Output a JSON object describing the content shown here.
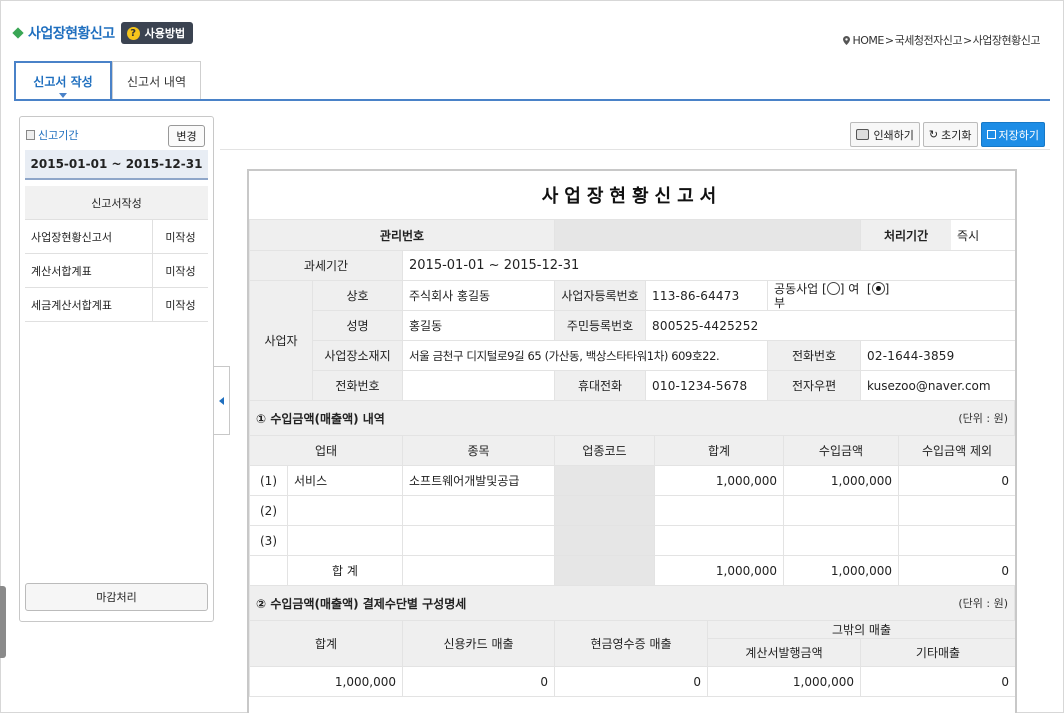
{
  "header": {
    "title": "사업장현황신고",
    "help_label": "사용방법",
    "breadcrumb": [
      "HOME",
      "국세청전자신고",
      "사업장현황신고"
    ],
    "bc_sep": ">"
  },
  "tabs": [
    {
      "label": "신고서 작성",
      "active": true
    },
    {
      "label": "신고서 내역",
      "active": false
    }
  ],
  "left_panel": {
    "period_label": "신고기간",
    "change_label": "변경",
    "period_value": "2015-01-01 ~ 2015-12-31",
    "list_header": "신고서작성",
    "items": [
      {
        "name": "사업장현황신고서",
        "status": "미작성"
      },
      {
        "name": "계산서합계표",
        "status": "미작성"
      },
      {
        "name": "세금계산서합계표",
        "status": "미작성"
      }
    ],
    "close_label": "마감처리"
  },
  "toolbar": {
    "print_label": "인쇄하기",
    "reset_label": "초기화",
    "save_label": "저장하기"
  },
  "form": {
    "title": "사업장현황신고서",
    "mgmt_no_label": "관리번호",
    "mgmt_no_value": "",
    "proc_period_label": "처리기간",
    "proc_period_value": "즉시",
    "tax_period_label": "과세기간",
    "tax_period_value": "2015-01-01 ~ 2015-12-31",
    "business_label": "사업자",
    "company_label": "상호",
    "company_value": "주식회사 홍길동",
    "bizno_label": "사업자등록번호",
    "bizno_value": "113-86-64473",
    "joint_label_1": "공동사업 [",
    "joint_label_2": "] 여",
    "joint_label_3": "[",
    "joint_label_4": "]",
    "joint_label_5": "부",
    "name_label": "성명",
    "name_value": "홍길동",
    "rrn_label": "주민등록번호",
    "rrn_value": "800525-4425252",
    "addr_label": "사업장소재지",
    "addr_value": "서울 금천구 디지털로9길 65 (가산동, 백상스타타워1차) 609호22.",
    "phone_label": "전화번호",
    "phone_value": "02-1644-3859",
    "phone2_label": "전화번호",
    "phone2_value": "",
    "mobile_label": "휴대전화",
    "mobile_value": "010-1234-5678",
    "email_label": "전자우편",
    "email_value": "kusezoo@naver.com"
  },
  "section1": {
    "title": "① 수입금액(매출액) 내역",
    "unit": "(단위 : 원)",
    "columns": [
      "업태",
      "종목",
      "업종코드",
      "합계",
      "수입금액",
      "수입금액 제외"
    ],
    "rows": [
      {
        "no": "(1)",
        "type": "서비스",
        "item": "소프트웨어개발및공급",
        "code": "",
        "total": "1,000,000",
        "income": "1,000,000",
        "excluded": "0"
      },
      {
        "no": "(2)",
        "type": "",
        "item": "",
        "code": "",
        "total": "",
        "income": "",
        "excluded": ""
      },
      {
        "no": "(3)",
        "type": "",
        "item": "",
        "code": "",
        "total": "",
        "income": "",
        "excluded": ""
      }
    ],
    "sum_label": "합 계",
    "sum_total": "1,000,000",
    "sum_income": "1,000,000",
    "sum_excluded": "0"
  },
  "section2": {
    "title": "② 수입금액(매출액) 결제수단별 구성명세",
    "unit": "(단위 : 원)",
    "col_total": "합계",
    "col_card": "신용카드 매출",
    "col_cash": "현금영수증 매출",
    "col_other": "그밖의 매출",
    "col_invoice": "계산서발행금액",
    "col_etc": "기타매출",
    "values": {
      "total": "1,000,000",
      "card": "0",
      "cash": "0",
      "invoice": "1,000,000",
      "etc": "0"
    }
  }
}
